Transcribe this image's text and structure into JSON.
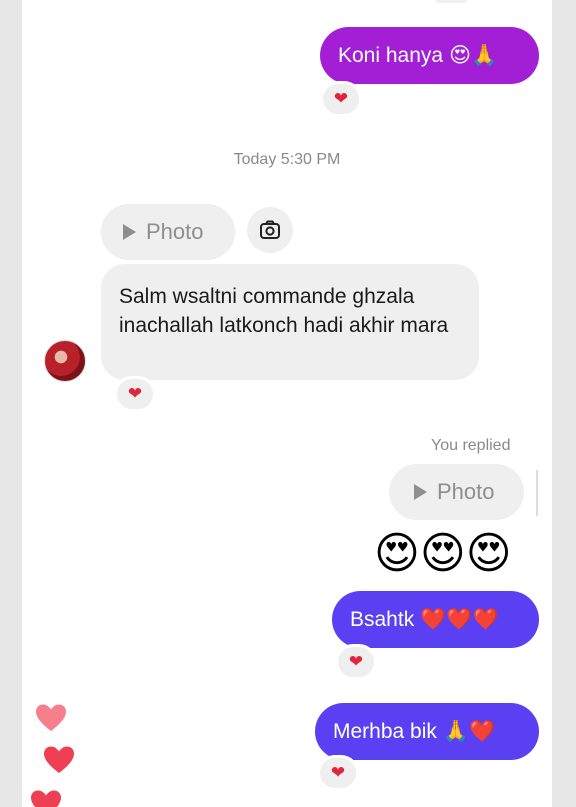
{
  "messages": {
    "msg1": {
      "text": "Koni hanya",
      "emoji": "😍🙏",
      "reaction": "❤"
    },
    "timestamp": "Today 5:30 PM",
    "photo_label": "Photo",
    "incoming": {
      "text": "Salm wsaltni commande ghzala inachallah latkonch hadi akhir mara",
      "reaction": "❤"
    },
    "you_replied": "You replied",
    "reply_photo_label": "Photo",
    "emoji_reply": "😍😍😍",
    "msg2": {
      "text": "Bsahtk",
      "emoji": "❤️❤️❤️",
      "reaction": "❤"
    },
    "msg3": {
      "text": "Merhba bik",
      "emoji": "🙏❤️",
      "reaction": "❤"
    }
  },
  "icons": {
    "play": "play-icon",
    "camera": "camera-icon",
    "heart": "heart-icon"
  },
  "colors": {
    "purple_bubble": "#a21fd6",
    "blue_bubble": "#5b3ff3",
    "incoming_bubble": "#efefef",
    "heart": "#e0263b"
  }
}
